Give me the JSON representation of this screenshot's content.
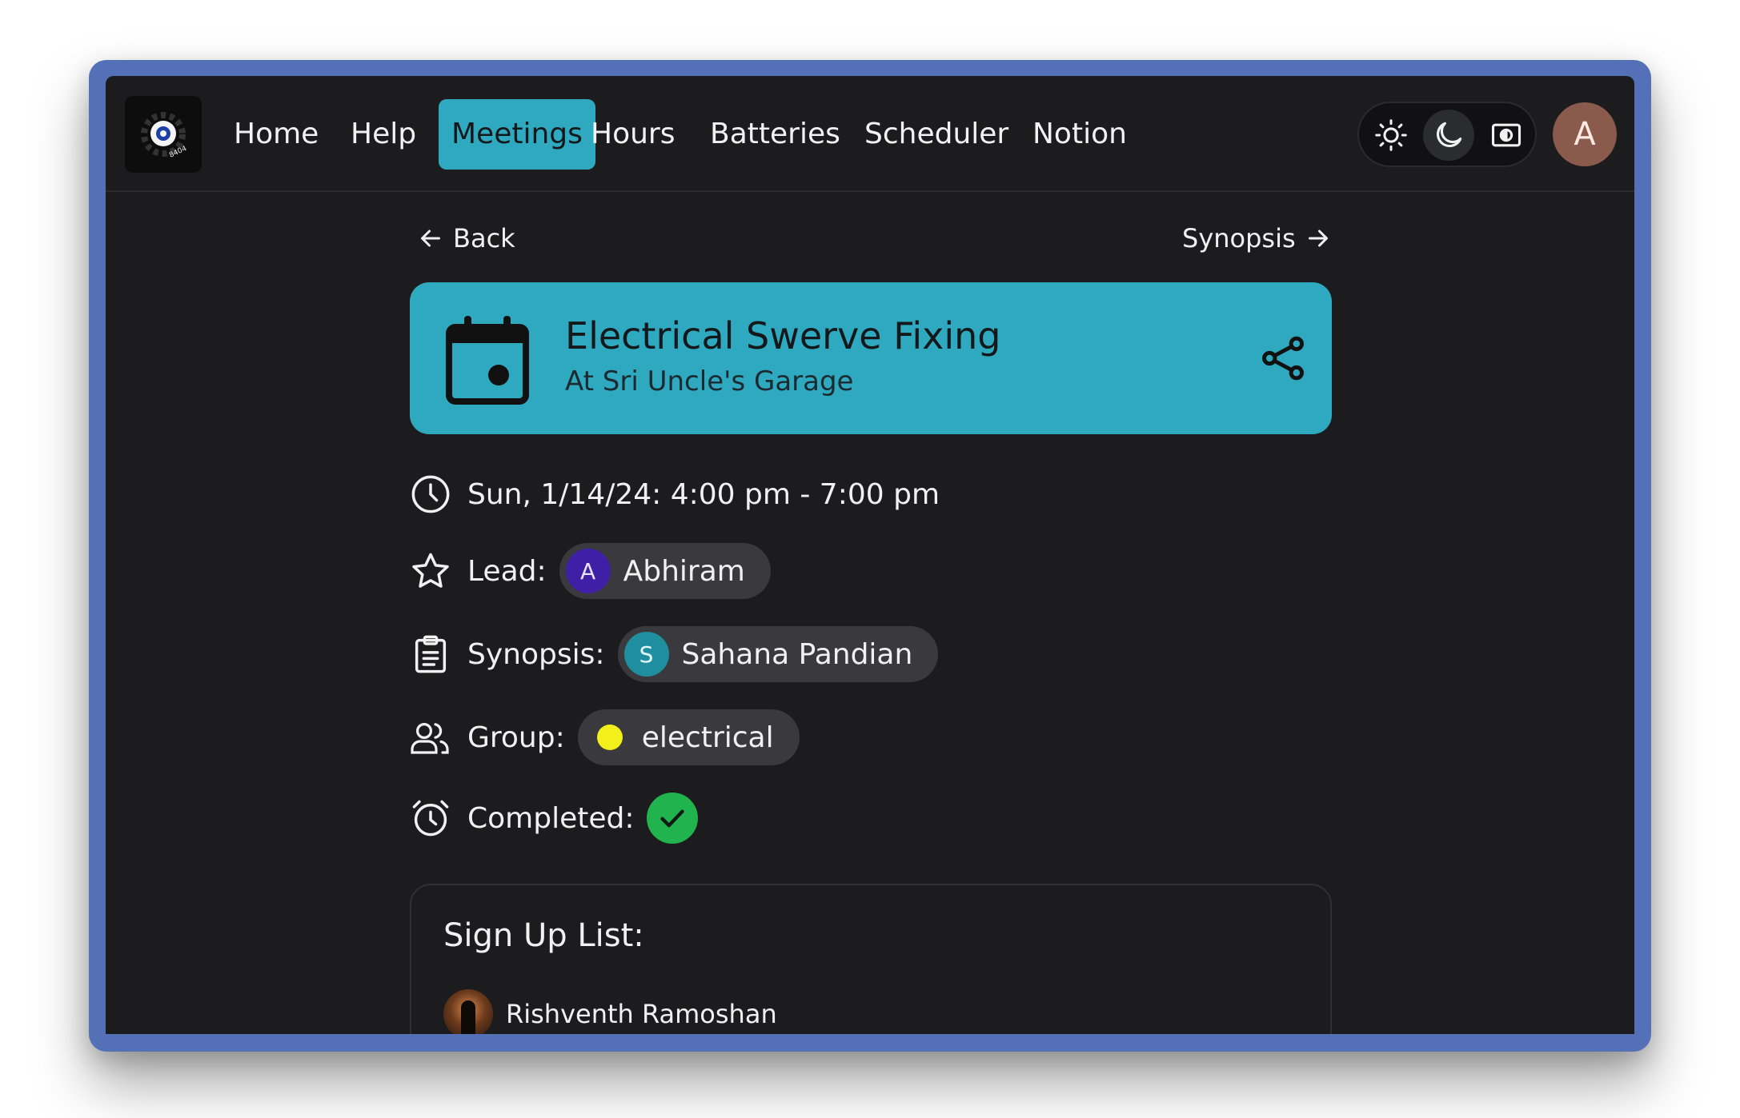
{
  "nav": {
    "logo_text": "8404",
    "links": [
      {
        "label": "Home"
      },
      {
        "label": "Help"
      },
      {
        "label": "Meetings",
        "active": true
      },
      {
        "label": "Hours"
      },
      {
        "label": "Batteries"
      },
      {
        "label": "Scheduler"
      },
      {
        "label": "Notion"
      }
    ],
    "theme_selected": "dark",
    "user_initial": "A"
  },
  "page": {
    "back_label": "Back",
    "synopsis_label": "Synopsis",
    "meeting": {
      "title": "Electrical Swerve Fixing",
      "location": "At Sri Uncle's Garage"
    },
    "datetime": "Sun, 1/14/24: 4:00 pm - 7:00 pm",
    "lead": {
      "label": "Lead:",
      "initial": "A",
      "name": "Abhiram",
      "color": "#3f1fa6"
    },
    "synopsis": {
      "label": "Synopsis:",
      "initial": "S",
      "name": "Sahana Pandian",
      "color": "#1f8fa0"
    },
    "group": {
      "label": "Group:",
      "name": "electrical",
      "color": "#f2ef1a"
    },
    "completed": {
      "label": "Completed:",
      "value": true
    },
    "signup": {
      "title": "Sign Up List:",
      "people": [
        {
          "name": "Rishventh Ramoshan"
        }
      ]
    }
  },
  "colors": {
    "accent": "#2ea9c0",
    "frame": "#5470b7",
    "background": "#1c1c1e",
    "success": "#21b34d"
  }
}
